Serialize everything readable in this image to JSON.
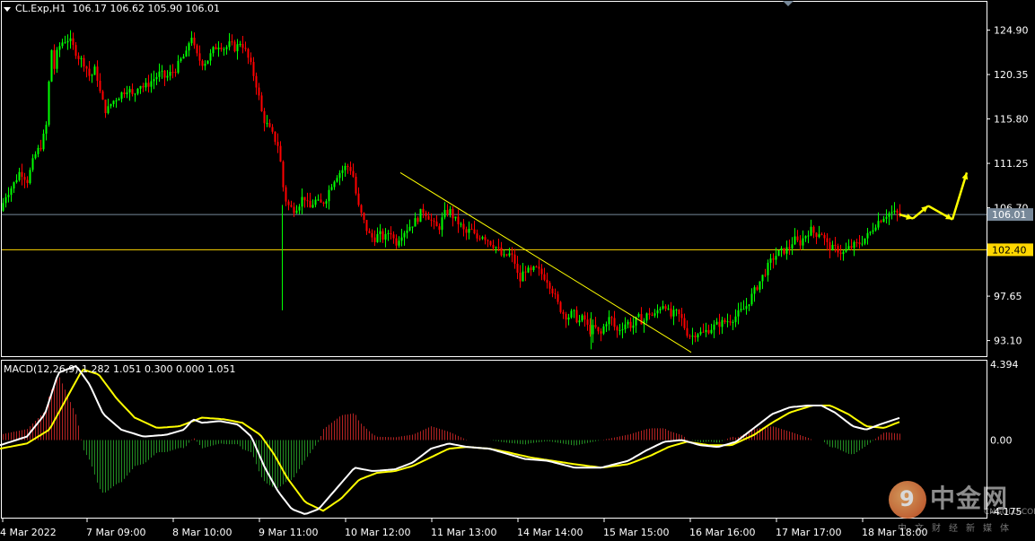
{
  "header": {
    "symbol": "CL.Exp,H1",
    "ohlc": "106.17 106.62 105.90 106.01"
  },
  "macd_header": {
    "text": "MACD(12,26,9) 1.282 1.051 0.300 0.000 1.051"
  },
  "logo": {
    "glyph": "9",
    "name": "中金网",
    "site": "CNGOLD.COM.CN",
    "tagline": "中文财经新媒体"
  },
  "colors": {
    "background": "#000000",
    "bull": "#00ff00",
    "bear": "#ff0000",
    "trendline": "#ffff00",
    "level_line": "#ffd700",
    "current_line": "#778899",
    "macd_main": "#ffffff",
    "macd_signal": "#ffff00",
    "hist_pos": "#b22222",
    "hist_neg": "#228b22"
  },
  "chart_data": [
    {
      "type": "candlestick",
      "title": "CL.Exp,H1",
      "y_ticks": [
        "124.90",
        "120.35",
        "115.80",
        "111.25",
        "106.70",
        "97.65",
        "93.10"
      ],
      "y_tick_values": [
        124.9,
        120.35,
        115.8,
        111.25,
        106.7,
        97.65,
        93.1
      ],
      "ylim": [
        91.5,
        127.8
      ],
      "x_ticks": [
        "4 Mar 2022",
        "7 Mar 09:00",
        "8 Mar 10:00",
        "9 Mar 11:00",
        "10 Mar 12:00",
        "11 Mar 13:00",
        "14 Mar 14:00",
        "15 Mar 15:00",
        "16 Mar 16:00",
        "17 Mar 17:00",
        "18 Mar 18:00"
      ],
      "current_price": {
        "label": "106.01",
        "value": 106.01
      },
      "level": {
        "label": "102.40",
        "value": 102.4
      },
      "close_path": [
        [
          0,
          106.4
        ],
        [
          6,
          108.0
        ],
        [
          14,
          109.0
        ],
        [
          22,
          110.5
        ],
        [
          30,
          109.5
        ],
        [
          38,
          112.0
        ],
        [
          46,
          113.2
        ],
        [
          52,
          115.5
        ],
        [
          56,
          123.5
        ],
        [
          60,
          121.0
        ],
        [
          64,
          123.0
        ],
        [
          70,
          123.8
        ],
        [
          76,
          124.0
        ],
        [
          82,
          123.0
        ],
        [
          88,
          122.0
        ],
        [
          94,
          121.5
        ],
        [
          100,
          120.0
        ],
        [
          106,
          121.0
        ],
        [
          112,
          118.0
        ],
        [
          118,
          116.5
        ],
        [
          124,
          117.5
        ],
        [
          130,
          118.0
        ],
        [
          136,
          118.5
        ],
        [
          142,
          119.0
        ],
        [
          148,
          118.0
        ],
        [
          154,
          119.5
        ],
        [
          160,
          119.0
        ],
        [
          166,
          119.5
        ],
        [
          172,
          120.0
        ],
        [
          178,
          120.5
        ],
        [
          184,
          120.0
        ],
        [
          190,
          120.5
        ],
        [
          196,
          121.0
        ],
        [
          202,
          122.0
        ],
        [
          208,
          122.5
        ],
        [
          212,
          124.8
        ],
        [
          216,
          123.0
        ],
        [
          220,
          122.0
        ],
        [
          226,
          121.5
        ],
        [
          232,
          122.0
        ],
        [
          238,
          123.0
        ],
        [
          244,
          123.5
        ],
        [
          250,
          123.0
        ],
        [
          256,
          123.5
        ],
        [
          262,
          123.0
        ],
        [
          268,
          123.8
        ],
        [
          274,
          122.5
        ],
        [
          280,
          121.0
        ],
        [
          286,
          119.0
        ],
        [
          292,
          116.0
        ],
        [
          298,
          115.0
        ],
        [
          304,
          114.0
        ],
        [
          310,
          113.0
        ],
        [
          316,
          108.0
        ],
        [
          320,
          107.0
        ],
        [
          326,
          106.5
        ],
        [
          332,
          107.0
        ],
        [
          338,
          108.0
        ],
        [
          344,
          106.5
        ],
        [
          350,
          107.5
        ],
        [
          356,
          107.0
        ],
        [
          362,
          107.5
        ],
        [
          368,
          109.0
        ],
        [
          374,
          110.0
        ],
        [
          380,
          110.5
        ],
        [
          386,
          111.0
        ],
        [
          392,
          110.5
        ],
        [
          398,
          107.0
        ],
        [
          404,
          105.5
        ],
        [
          410,
          104.0
        ],
        [
          416,
          103.5
        ],
        [
          422,
          104.0
        ],
        [
          428,
          103.5
        ],
        [
          434,
          104.5
        ],
        [
          440,
          103.0
        ],
        [
          446,
          104.0
        ],
        [
          452,
          104.5
        ],
        [
          458,
          105.0
        ],
        [
          464,
          105.5
        ],
        [
          470,
          106.5
        ],
        [
          476,
          106.0
        ],
        [
          482,
          105.0
        ],
        [
          488,
          104.5
        ],
        [
          494,
          106.0
        ],
        [
          500,
          106.5
        ],
        [
          506,
          105.5
        ],
        [
          512,
          105.0
        ],
        [
          518,
          104.0
        ],
        [
          524,
          104.5
        ],
        [
          530,
          103.5
        ],
        [
          536,
          104.0
        ],
        [
          542,
          103.5
        ],
        [
          548,
          103.0
        ],
        [
          554,
          102.5
        ],
        [
          560,
          101.5
        ],
        [
          566,
          102.0
        ],
        [
          572,
          101.5
        ],
        [
          578,
          99.0
        ],
        [
          584,
          100.5
        ],
        [
          590,
          100.0
        ],
        [
          596,
          100.5
        ],
        [
          602,
          100.0
        ],
        [
          608,
          99.5
        ],
        [
          614,
          98.5
        ],
        [
          620,
          97.0
        ],
        [
          626,
          96.0
        ],
        [
          632,
          95.5
        ],
        [
          638,
          96.0
        ],
        [
          644,
          95.0
        ],
        [
          650,
          95.5
        ],
        [
          656,
          94.0
        ],
        [
          662,
          94.5
        ],
        [
          668,
          93.5
        ],
        [
          674,
          95.0
        ],
        [
          680,
          95.5
        ],
        [
          686,
          94.0
        ],
        [
          692,
          94.5
        ],
        [
          698,
          95.0
        ],
        [
          704,
          94.5
        ],
        [
          710,
          95.5
        ],
        [
          716,
          95.0
        ],
        [
          722,
          96.0
        ],
        [
          728,
          95.5
        ],
        [
          734,
          96.5
        ],
        [
          740,
          97.0
        ],
        [
          746,
          95.5
        ],
        [
          752,
          96.0
        ],
        [
          758,
          95.5
        ],
        [
          764,
          94.0
        ],
        [
          770,
          93.5
        ],
        [
          776,
          94.0
        ],
        [
          782,
          93.8
        ],
        [
          788,
          94.2
        ],
        [
          794,
          94.5
        ],
        [
          800,
          94.8
        ],
        [
          806,
          95.0
        ],
        [
          812,
          95.2
        ],
        [
          818,
          95.5
        ],
        [
          824,
          96.0
        ],
        [
          830,
          96.5
        ],
        [
          836,
          97.5
        ],
        [
          842,
          98.5
        ],
        [
          848,
          99.5
        ],
        [
          854,
          100.5
        ],
        [
          860,
          101.5
        ],
        [
          866,
          102.0
        ],
        [
          872,
          102.3
        ],
        [
          878,
          102.5
        ],
        [
          884,
          103.5
        ],
        [
          890,
          103.0
        ],
        [
          896,
          103.8
        ],
        [
          902,
          104.5
        ],
        [
          908,
          104.0
        ],
        [
          914,
          104.3
        ],
        [
          920,
          103.0
        ],
        [
          926,
          102.5
        ],
        [
          932,
          102.5
        ],
        [
          938,
          102.0
        ],
        [
          944,
          102.5
        ],
        [
          950,
          102.8
        ],
        [
          956,
          103.0
        ],
        [
          962,
          103.5
        ],
        [
          968,
          104.0
        ],
        [
          974,
          105.0
        ],
        [
          980,
          105.5
        ],
        [
          986,
          106.0
        ],
        [
          992,
          106.2
        ],
        [
          998,
          106.1
        ],
        [
          1004,
          106.01
        ]
      ],
      "trendline_start": [
        "10 Mar 12:00",
        110.3
      ],
      "trendline_end": [
        "16 Mar 16:00",
        91.9
      ],
      "projection_arrows": [
        {
          "from": [
            "18 Mar 18:00",
            106.01
          ],
          "to": [
            106.5,
            105.5
          ]
        },
        {
          "from": [
            105.5
          ],
          "to": [
            106.9
          ]
        },
        {
          "from": [
            106.9
          ],
          "to": [
            105.5
          ]
        },
        {
          "from": [
            105.5
          ],
          "to": [
            110.5
          ]
        }
      ]
    },
    {
      "type": "macd",
      "title": "MACD(12,26,9)",
      "params": "12,26,9",
      "values": {
        "main": 1.282,
        "signal": 1.051,
        "hist": 0.3
      },
      "y_ticks": [
        "4.394",
        "0.00",
        "-4.175"
      ],
      "y_tick_values": [
        4.394,
        0.0,
        -4.175
      ],
      "ylim": [
        -4.5,
        4.6
      ],
      "main": [
        [
          0,
          -0.3
        ],
        [
          30,
          0.2
        ],
        [
          50,
          1.5
        ],
        [
          65,
          3.9
        ],
        [
          85,
          4.3
        ],
        [
          100,
          3.2
        ],
        [
          115,
          1.5
        ],
        [
          135,
          0.6
        ],
        [
          160,
          0.2
        ],
        [
          185,
          0.3
        ],
        [
          205,
          0.6
        ],
        [
          215,
          1.2
        ],
        [
          225,
          1.0
        ],
        [
          245,
          1.1
        ],
        [
          265,
          0.9
        ],
        [
          280,
          0.2
        ],
        [
          295,
          -1.6
        ],
        [
          310,
          -3.0
        ],
        [
          325,
          -4.0
        ],
        [
          340,
          -4.3
        ],
        [
          355,
          -4.0
        ],
        [
          375,
          -2.8
        ],
        [
          395,
          -1.6
        ],
        [
          415,
          -1.8
        ],
        [
          440,
          -1.7
        ],
        [
          460,
          -1.3
        ],
        [
          480,
          -0.5
        ],
        [
          500,
          -0.2
        ],
        [
          520,
          -0.4
        ],
        [
          545,
          -0.5
        ],
        [
          565,
          -0.8
        ],
        [
          585,
          -1.1
        ],
        [
          610,
          -1.2
        ],
        [
          640,
          -1.6
        ],
        [
          670,
          -1.6
        ],
        [
          700,
          -1.2
        ],
        [
          720,
          -0.6
        ],
        [
          740,
          -0.1
        ],
        [
          760,
          0.0
        ],
        [
          780,
          -0.3
        ],
        [
          800,
          -0.4
        ],
        [
          820,
          -0.1
        ],
        [
          840,
          0.7
        ],
        [
          860,
          1.5
        ],
        [
          880,
          1.9
        ],
        [
          900,
          2.0
        ],
        [
          915,
          2.0
        ],
        [
          930,
          1.6
        ],
        [
          950,
          0.8
        ],
        [
          965,
          0.6
        ],
        [
          980,
          0.9
        ],
        [
          1002,
          1.28
        ]
      ],
      "signal": [
        [
          0,
          -0.5
        ],
        [
          30,
          -0.2
        ],
        [
          55,
          0.6
        ],
        [
          75,
          2.5
        ],
        [
          92,
          4.1
        ],
        [
          110,
          3.8
        ],
        [
          130,
          2.4
        ],
        [
          150,
          1.3
        ],
        [
          175,
          0.7
        ],
        [
          200,
          0.8
        ],
        [
          225,
          1.3
        ],
        [
          250,
          1.2
        ],
        [
          270,
          1.0
        ],
        [
          290,
          0.3
        ],
        [
          305,
          -0.8
        ],
        [
          320,
          -2.2
        ],
        [
          340,
          -3.6
        ],
        [
          360,
          -4.1
        ],
        [
          380,
          -3.4
        ],
        [
          400,
          -2.3
        ],
        [
          420,
          -1.9
        ],
        [
          440,
          -1.8
        ],
        [
          460,
          -1.5
        ],
        [
          480,
          -1.0
        ],
        [
          500,
          -0.5
        ],
        [
          520,
          -0.4
        ],
        [
          545,
          -0.5
        ],
        [
          565,
          -0.7
        ],
        [
          590,
          -1.0
        ],
        [
          615,
          -1.2
        ],
        [
          640,
          -1.4
        ],
        [
          670,
          -1.6
        ],
        [
          700,
          -1.4
        ],
        [
          725,
          -0.9
        ],
        [
          745,
          -0.4
        ],
        [
          765,
          -0.1
        ],
        [
          790,
          -0.3
        ],
        [
          815,
          -0.3
        ],
        [
          840,
          0.3
        ],
        [
          860,
          1.0
        ],
        [
          880,
          1.6
        ],
        [
          905,
          2.0
        ],
        [
          925,
          2.0
        ],
        [
          945,
          1.5
        ],
        [
          965,
          0.8
        ],
        [
          985,
          0.7
        ],
        [
          1002,
          1.05
        ]
      ]
    }
  ]
}
